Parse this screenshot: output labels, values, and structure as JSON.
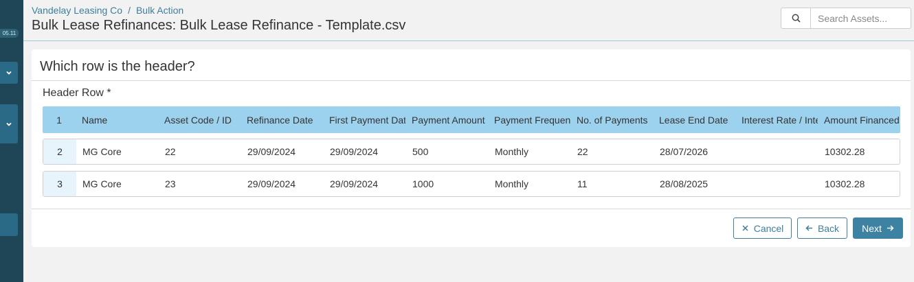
{
  "sidebar": {
    "version": "05.11"
  },
  "header": {
    "breadcrumb": [
      "Vandelay Leasing Co",
      "Bulk Action"
    ],
    "breadcrumb_separator": "/",
    "title": "Bulk Lease Refinances: Bulk Lease Refinance - Template.csv"
  },
  "search": {
    "placeholder": "Search Assets..."
  },
  "card": {
    "title": "Which row is the header?",
    "field_label": "Header Row *"
  },
  "grid": {
    "header": {
      "index": "1",
      "cells": [
        "Name",
        "Asset Code / ID",
        "Refinance Date",
        "First Payment Date",
        "Payment Amount",
        "Payment Frequency",
        "No. of Payments",
        "Lease End Date",
        "Interest Rate / Interest",
        "Amount Financed"
      ]
    },
    "rows": [
      {
        "index": "2",
        "cells": [
          "MG Core",
          "22",
          "29/09/2024",
          "29/09/2024",
          "500",
          "Monthly",
          "22",
          "28/07/2026",
          "",
          "10302.28"
        ]
      },
      {
        "index": "3",
        "cells": [
          "MG Core",
          "23",
          "29/09/2024",
          "29/09/2024",
          "1000",
          "Monthly",
          "11",
          "28/08/2025",
          "",
          "10302.28"
        ]
      }
    ]
  },
  "actions": {
    "cancel": "Cancel",
    "back": "Back",
    "next": "Next"
  },
  "colors": {
    "sidebar": "#1f4656",
    "accent": "#3e7e9c",
    "header_row": "#9dd2ee"
  }
}
